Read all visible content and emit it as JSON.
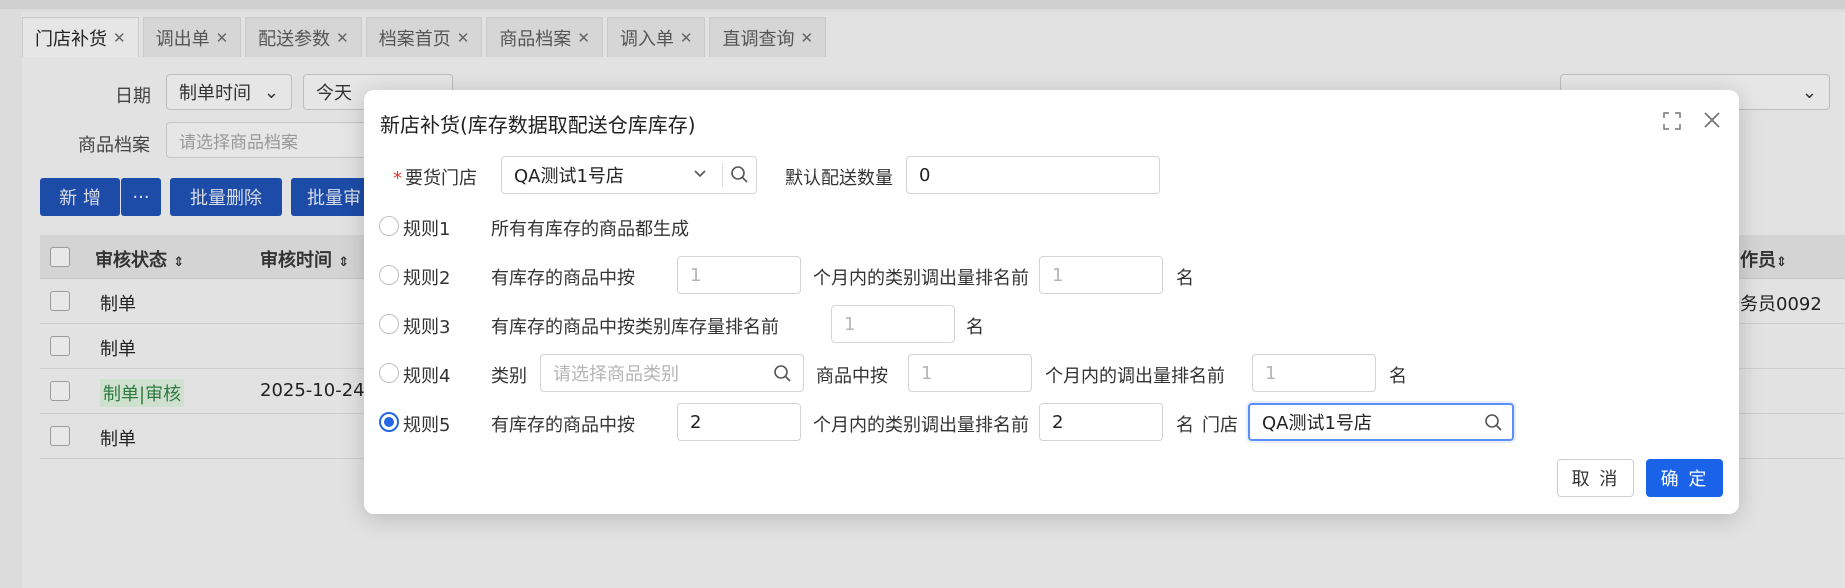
{
  "tabs": [
    {
      "label": "门店补货",
      "active": true
    },
    {
      "label": "调出单",
      "active": false
    },
    {
      "label": "配送参数",
      "active": false
    },
    {
      "label": "档案首页",
      "active": false
    },
    {
      "label": "商品档案",
      "active": false
    },
    {
      "label": "调入单",
      "active": false
    },
    {
      "label": "直调查询",
      "active": false
    }
  ],
  "filters": {
    "date_label": "日期",
    "date_type": "制单时间",
    "date_range": "今天",
    "product_label": "商品档案",
    "product_placeholder": "请选择商品档案"
  },
  "toolbar": {
    "add": "新 增",
    "more": "···",
    "batch_delete": "批量删除",
    "batch_audit_partial": "批量审"
  },
  "table": {
    "headers": [
      "审核状态",
      "审核时间",
      "作员"
    ],
    "rows": [
      {
        "status": "制单",
        "time": "",
        "operator": "务员0092"
      },
      {
        "status": "制单",
        "time": "",
        "operator": ""
      },
      {
        "status": "制单|审核",
        "time": "2025-10-24",
        "operator": ""
      },
      {
        "status": "制单",
        "time": "",
        "operator": ""
      }
    ]
  },
  "modal": {
    "title": "新店补货(库存数据取配送仓库库存)",
    "store_label": "要货门店",
    "store_value": "QA测试1号店",
    "default_qty_label": "默认配送数量",
    "default_qty_value": "0",
    "rule1": {
      "label": "规则1",
      "text": "所有有库存的商品都生成"
    },
    "rule2": {
      "label": "规则2",
      "text_a": "有库存的商品中按",
      "months_placeholder": "1",
      "text_b": "个月内的类别调出量排名前",
      "rank_placeholder": "1",
      "unit": "名"
    },
    "rule3": {
      "label": "规则3",
      "text_a": "有库存的商品中按类别库存量排名前",
      "rank_placeholder": "1",
      "unit": "名"
    },
    "rule4": {
      "label": "规则4",
      "category_label": "类别",
      "category_placeholder": "请选择商品类别",
      "text_a": "商品中按",
      "months_placeholder": "1",
      "text_b": "个月内的调出量排名前",
      "rank_placeholder": "1",
      "unit": "名"
    },
    "rule5": {
      "label": "规则5",
      "selected": true,
      "text_a": "有库存的商品中按",
      "months_value": "2",
      "text_b": "个月内的类别调出量排名前",
      "rank_value": "2",
      "unit": "名",
      "store_label": "门店",
      "store_value": "QA测试1号店"
    },
    "cancel": "取 消",
    "confirm": "确 定"
  },
  "colors": {
    "primary": "#1a63e9",
    "required": "#e5322d",
    "green_status": "#2f7a3f"
  }
}
